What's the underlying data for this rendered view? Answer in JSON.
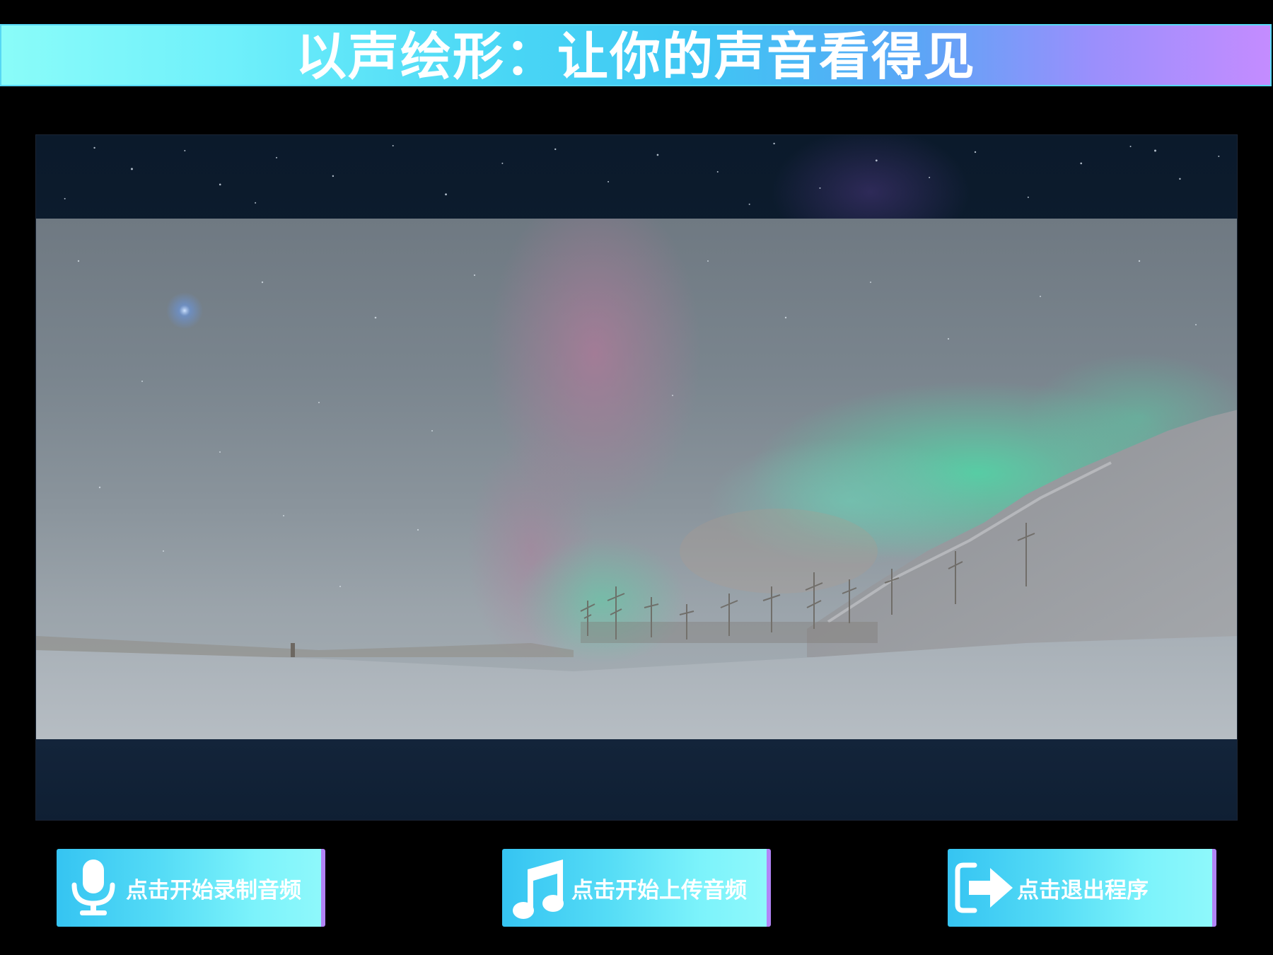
{
  "header": {
    "title": "以声绘形：让你的声音看得见"
  },
  "display": {
    "background_image": "aurora-night-sky-snow"
  },
  "buttons": {
    "record": {
      "label": "点击开始录制音频",
      "icon": "microphone-icon"
    },
    "upload": {
      "label": "点击开始上传音频",
      "icon": "music-note-icon"
    },
    "exit": {
      "label": "点击退出程序",
      "icon": "exit-arrow-icon"
    }
  },
  "colors": {
    "title_gradient_start": "#8afcf9",
    "title_gradient_end": "#c48cff",
    "button_gradient_start": "#35c4f2",
    "button_gradient_end": "#8ef8fb",
    "button_edge": "#b184f7",
    "page_background": "#000000"
  }
}
